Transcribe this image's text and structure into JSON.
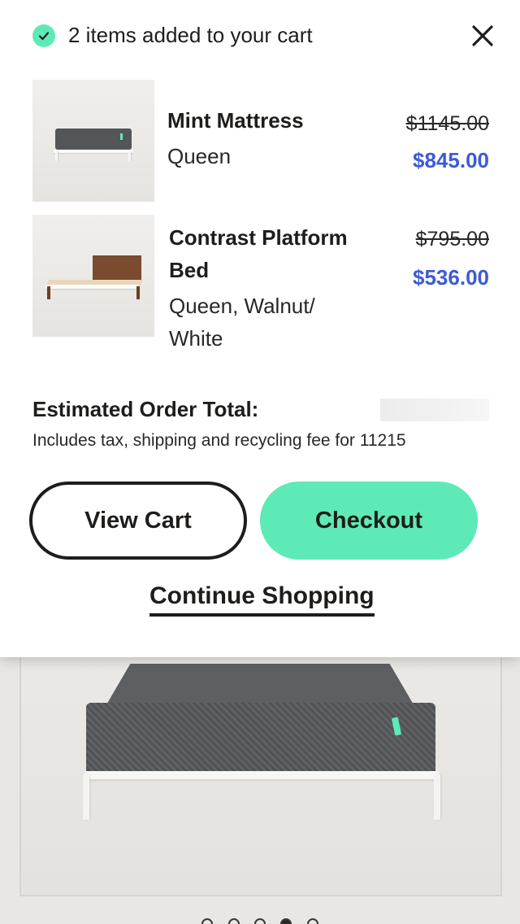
{
  "modal": {
    "header": "2 items added to your cart",
    "items": [
      {
        "name": "Mint Mattress",
        "variant": "Queen",
        "price_original": "$1145.00",
        "price_sale": "$845.00"
      },
      {
        "name_line1": "Contrast Platform",
        "name_line2": "Bed",
        "variant_line1": "Queen, Walnut/",
        "variant_line2": "White",
        "price_original": "$795.00",
        "price_sale": "$536.00"
      }
    ],
    "total_label": "Estimated Order Total:",
    "total_note": "Includes tax, shipping and recycling fee for 11215",
    "view_cart_label": "View Cart",
    "checkout_label": "Checkout",
    "continue_label": "Continue Shopping"
  },
  "carousel": {
    "slide_count": 5,
    "active_index": 3
  },
  "colors": {
    "accent": "#5eeab7",
    "sale_price": "#3b5bd6",
    "text": "#1f1d1b"
  },
  "icons": [
    "check-icon",
    "close-icon"
  ]
}
